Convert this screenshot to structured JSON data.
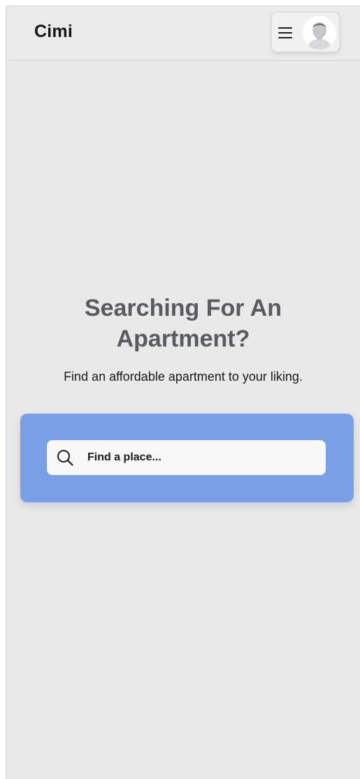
{
  "header": {
    "logo": "Cimi"
  },
  "hero": {
    "title_line1": "Searching For An",
    "title_line2": "Apartment?",
    "subtitle": "Find an affordable apartment to your liking."
  },
  "search": {
    "placeholder": "Find a place...",
    "value": ""
  },
  "colors": {
    "background": "#e9e9ea",
    "search_panel": "#799fe6",
    "title": "#585b60"
  },
  "icons": {
    "menu": "hamburger-menu-icon",
    "avatar": "user-avatar-icon",
    "search": "search-icon"
  }
}
